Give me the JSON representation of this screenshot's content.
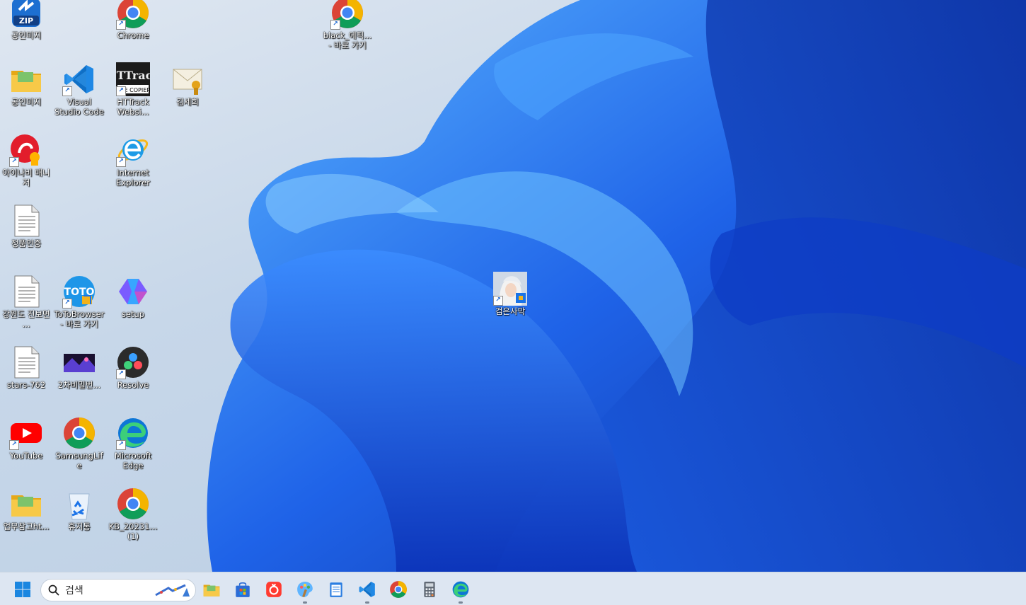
{
  "desktop": {
    "icons": [
      {
        "label": "공인미지",
        "icon": "zip-archive-icon",
        "shortcut": false
      },
      {
        "label": "Chrome",
        "icon": "chrome-icon",
        "shortcut": true
      },
      {
        "label": "black_에픽... - 바로 가기",
        "icon": "chrome-icon",
        "shortcut": true
      },
      {
        "label": "공인미지",
        "icon": "folder-icon",
        "shortcut": false
      },
      {
        "label": "Visual Studio Code",
        "icon": "vscode-icon",
        "shortcut": true
      },
      {
        "label": "HTTrack Websi...",
        "icon": "httrack-icon",
        "shortcut": true
      },
      {
        "label": "김세희",
        "icon": "certificate-icon",
        "shortcut": false
      },
      {
        "label": "아이나비 매니저",
        "icon": "inavi-icon",
        "shortcut": true
      },
      {
        "label": "Internet Explorer",
        "icon": "internet-explorer-icon",
        "shortcut": true
      },
      {
        "label": "정품인증",
        "icon": "text-file-icon",
        "shortcut": false
      },
      {
        "label": "검은사막",
        "icon": "black-desert-icon",
        "shortcut": true
      },
      {
        "label": "강원도 진보면 ...",
        "icon": "text-file-icon",
        "shortcut": false
      },
      {
        "label": "ToToBrowser - 바로 가기",
        "icon": "totobrowser-icon",
        "shortcut": true
      },
      {
        "label": "setup",
        "icon": "copilot-icon",
        "shortcut": false
      },
      {
        "label": "stars-762",
        "icon": "text-file-icon",
        "shortcut": false
      },
      {
        "label": "2차비밀번...",
        "icon": "image-file-icon",
        "shortcut": false
      },
      {
        "label": "Resolve",
        "icon": "davinci-resolve-icon",
        "shortcut": true
      },
      {
        "label": "YouTube",
        "icon": "youtube-icon",
        "shortcut": true
      },
      {
        "label": "SamsungLife",
        "icon": "chrome-icon",
        "shortcut": false
      },
      {
        "label": "Microsoft Edge",
        "icon": "edge-icon",
        "shortcut": true
      },
      {
        "label": "업무참고ht...",
        "icon": "folder-icon",
        "shortcut": false
      },
      {
        "label": "휴지통",
        "icon": "recycle-bin-icon",
        "shortcut": false
      },
      {
        "label": "KB_20231... (1)",
        "icon": "chrome-icon",
        "shortcut": false
      }
    ]
  },
  "taskbar": {
    "search_placeholder": "검색",
    "pinned": [
      {
        "name": "file-explorer",
        "icon": "folder-icon",
        "running": false
      },
      {
        "name": "microsoft-store",
        "icon": "store-icon",
        "running": false
      },
      {
        "name": "app-red",
        "icon": "red-app-icon",
        "running": false
      },
      {
        "name": "paint",
        "icon": "paint-icon",
        "running": true
      },
      {
        "name": "notepad",
        "icon": "notepad-icon",
        "running": false
      },
      {
        "name": "vscode",
        "icon": "vscode-icon",
        "running": true
      },
      {
        "name": "chrome",
        "icon": "chrome-icon",
        "running": false
      },
      {
        "name": "calculator",
        "icon": "calculator-icon",
        "running": false
      },
      {
        "name": "edge",
        "icon": "edge-icon",
        "running": true
      }
    ]
  },
  "colors": {
    "wallpaper_blue": "#1a4fd8",
    "wallpaper_light": "#4aa3ff",
    "taskbar_bg": "#dde6f2"
  }
}
